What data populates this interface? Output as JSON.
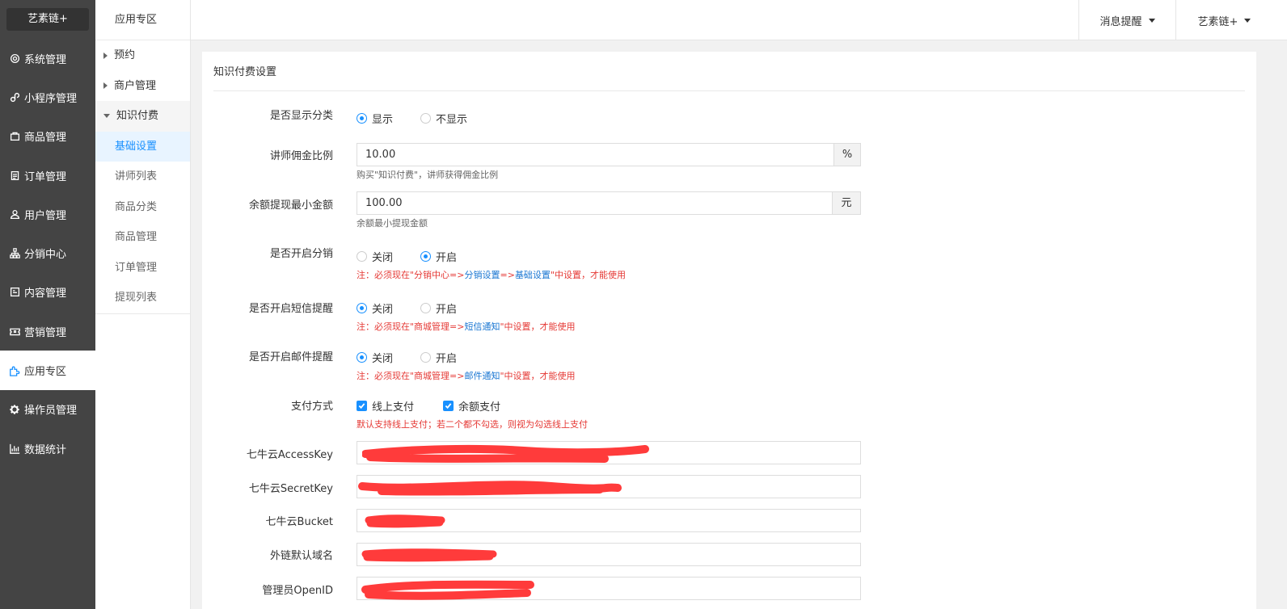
{
  "brand": "艺素链+",
  "sidebar": {
    "items": [
      {
        "label": "系统管理",
        "icon": "gear-icon"
      },
      {
        "label": "小程序管理",
        "icon": "miniprogram-icon"
      },
      {
        "label": "商品管理",
        "icon": "bag-icon"
      },
      {
        "label": "订单管理",
        "icon": "clipboard-icon"
      },
      {
        "label": "用户管理",
        "icon": "user-icon"
      },
      {
        "label": "分销中心",
        "icon": "sitemap-icon"
      },
      {
        "label": "内容管理",
        "icon": "content-icon"
      },
      {
        "label": "营销管理",
        "icon": "ticket-icon"
      },
      {
        "label": "应用专区",
        "icon": "puzzle-icon"
      },
      {
        "label": "操作员管理",
        "icon": "cog-icon"
      },
      {
        "label": "数据统计",
        "icon": "chart-icon"
      }
    ],
    "active_index": 8
  },
  "subbar": {
    "title": "应用专区",
    "groups": [
      {
        "label": "预约",
        "open": false
      },
      {
        "label": "商户管理",
        "open": false
      },
      {
        "label": "知识付费",
        "open": true
      }
    ],
    "items": [
      "基础设置",
      "讲师列表",
      "商品分类",
      "商品管理",
      "订单管理",
      "提现列表"
    ],
    "active_item": "基础设置"
  },
  "topbar": {
    "messages": "消息提醒",
    "user": "艺素链+"
  },
  "panel": {
    "title": "知识付费设置"
  },
  "form": {
    "show_category": {
      "label": "是否显示分类",
      "options": [
        "显示",
        "不显示"
      ],
      "selected": "显示"
    },
    "commission": {
      "label": "讲师佣金比例",
      "value": "10.00",
      "addon": "%",
      "help": "购买\"知识付费\"，讲师获得佣金比例"
    },
    "withdraw_min": {
      "label": "余额提现最小金额",
      "value": "100.00",
      "addon": "元",
      "help": "余额最小提现金额"
    },
    "distribution": {
      "label": "是否开启分销",
      "options": [
        "关闭",
        "开启"
      ],
      "selected": "开启",
      "note_prefix": "注：必须现在\"分销中心=>",
      "note_link1": "分销设置",
      "note_mid": "=>",
      "note_link2": "基础设置",
      "note_suffix": "\"中设置，才能使用"
    },
    "sms": {
      "label": "是否开启短信提醒",
      "options": [
        "关闭",
        "开启"
      ],
      "selected": "关闭",
      "note_prefix": "注：必须现在\"商城管理=>",
      "note_link": "短信通知",
      "note_suffix": "\"中设置，才能使用"
    },
    "email": {
      "label": "是否开启邮件提醒",
      "options": [
        "关闭",
        "开启"
      ],
      "selected": "关闭",
      "note_prefix": "注：必须现在\"商城管理=>",
      "note_link": "邮件通知",
      "note_suffix": "\"中设置，才能使用"
    },
    "payment": {
      "label": "支付方式",
      "options": [
        "线上支付",
        "余额支付"
      ],
      "note": "默认支持线上支付；若二个都不勾选，则视为勾选线上支付"
    },
    "qiniu_access": {
      "label": "七牛云AccessKey"
    },
    "qiniu_secret": {
      "label": "七牛云SecretKey"
    },
    "qiniu_bucket": {
      "label": "七牛云Bucket"
    },
    "domain": {
      "label": "外链默认域名"
    },
    "admin_openid": {
      "label": "管理员OpenID"
    }
  },
  "colors": {
    "sidebar_bg": "#444444",
    "accent": "#1890ff",
    "note_red": "#e53935",
    "redaction": "#ff3b3b"
  }
}
